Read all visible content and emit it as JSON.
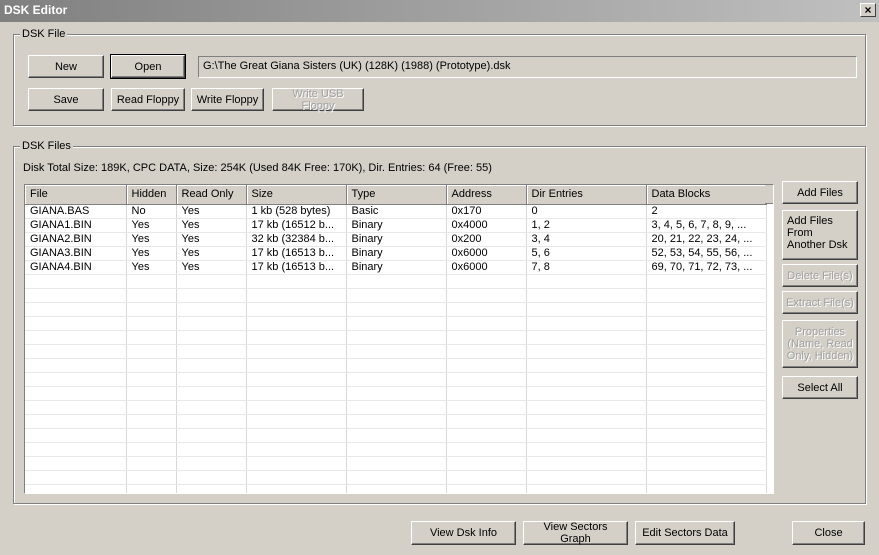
{
  "window": {
    "title": "DSK Editor",
    "close_glyph": "×"
  },
  "dsk_file": {
    "legend": "DSK File",
    "new_label": "New",
    "open_label": "Open",
    "save_label": "Save",
    "read_floppy_label": "Read Floppy",
    "write_floppy_label": "Write Floppy",
    "write_usb_floppy_label": "Write USB Floppy",
    "path": "G:\\The Great Giana Sisters (UK) (128K) (1988) (Prototype).dsk"
  },
  "dsk_files": {
    "legend": "DSK Files",
    "summary": "Disk Total Size: 189K, CPC DATA, Size: 254K (Used 84K  Free: 170K), Dir. Entries: 64 (Free: 55)",
    "columns": [
      "File",
      "Hidden",
      "Read Only",
      "Size",
      "Type",
      "Address",
      "Dir Entries",
      "Data Blocks"
    ],
    "rows": [
      [
        "GIANA.BAS",
        "No",
        "Yes",
        "1 kb (528 bytes)",
        "Basic",
        "0x170",
        "0",
        "2"
      ],
      [
        "GIANA1.BIN",
        "Yes",
        "Yes",
        "17 kb (16512 b...",
        "Binary",
        "0x4000",
        "1, 2",
        "3, 4, 5, 6, 7, 8, 9, ..."
      ],
      [
        "GIANA2.BIN",
        "Yes",
        "Yes",
        "32 kb (32384 b...",
        "Binary",
        "0x200",
        "3, 4",
        "20, 21, 22, 23, 24, ..."
      ],
      [
        "GIANA3.BIN",
        "Yes",
        "Yes",
        "17 kb (16513 b...",
        "Binary",
        "0x6000",
        "5, 6",
        "52, 53, 54, 55, 56, ..."
      ],
      [
        "GIANA4.BIN",
        "Yes",
        "Yes",
        "17 kb (16513 b...",
        "Binary",
        "0x6000",
        "7, 8",
        "69, 70, 71, 72, 73, ..."
      ]
    ],
    "add_files_label": "Add Files",
    "add_from_disk_label": "Add Files From Another Dsk",
    "delete_label": "Delete File(s)",
    "extract_label": "Extract File(s)",
    "properties_label": "Properties (Name, Read Only, Hidden)",
    "select_all_label": "Select All"
  },
  "footer": {
    "view_info_label": "View Dsk Info",
    "view_sectors_label": "View Sectors Graph",
    "edit_sectors_label": "Edit Sectors Data",
    "close_label": "Close"
  }
}
